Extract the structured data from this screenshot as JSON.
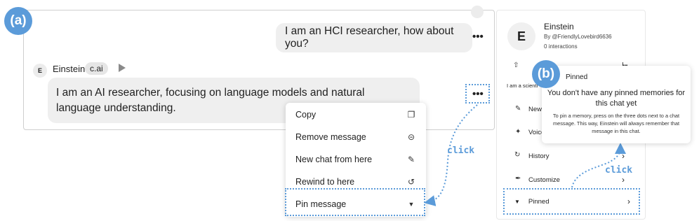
{
  "badges": {
    "a": "(a)",
    "b": "(b)"
  },
  "panel_a": {
    "user_message": "I am an HCI researcher, how about you?",
    "bot": {
      "avatar_letter": "E",
      "name": "Einstein",
      "tag": "c.ai",
      "message": "I am an AI researcher, focusing on language models and natural language understanding."
    },
    "more_icon": "•••",
    "menu": [
      {
        "label": "Copy",
        "icon": "copy-icon",
        "glyph": "❐"
      },
      {
        "label": "Remove message",
        "icon": "minus-circle-icon",
        "glyph": "⊝"
      },
      {
        "label": "New chat from here",
        "icon": "edit-icon",
        "glyph": "✎"
      },
      {
        "label": "Rewind to here",
        "icon": "rewind-icon",
        "glyph": "↺"
      },
      {
        "label": "Pin message",
        "icon": "pin-icon",
        "glyph": "▼"
      }
    ],
    "click_label": "click"
  },
  "panel_b": {
    "avatar_letter": "E",
    "name": "Einstein",
    "by": "By @FriendlyLovebird6636",
    "interactions": "0 interactions",
    "action_fragment": "I",
    "more_icon": "•••",
    "description_fragment": "I am a scienti",
    "rows": {
      "new_chat": "New ch",
      "voice": "Voice",
      "history": "History",
      "customize": "Customize",
      "pinned": "Pinned"
    },
    "chevron": "›",
    "popup": {
      "back": "›",
      "title": "Pinned",
      "heading": "You don't have any pinned memories for this chat yet",
      "description": "To pin a memory, press on the three dots next to a chat message. This way, Einstein will always remember that message in this chat."
    },
    "click_label": "click"
  },
  "colors": {
    "accent": "#5b9bd9",
    "bubble": "#efefef"
  }
}
